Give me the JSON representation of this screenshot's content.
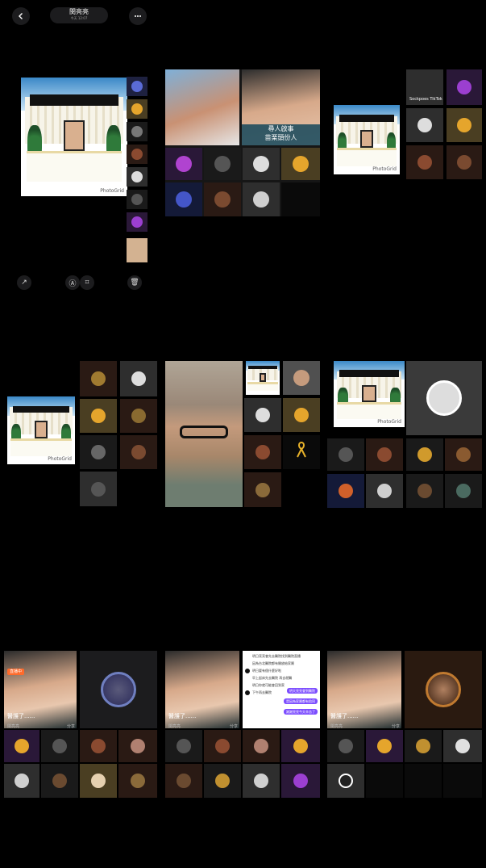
{
  "header": {
    "title": "閔亮亮",
    "subtitle": "今天 12:07",
    "back_icon": "chevron-left-icon",
    "more_icon": "more-dots-icon"
  },
  "viewer": {
    "watermark": "PhotoGrid",
    "actions": [
      "share-icon",
      "text-recognize-icon",
      "scan-icon",
      "trash-icon"
    ]
  },
  "panel2": {
    "caption_line1": "尋人啟事",
    "caption_line2": "苗栗頭份人"
  },
  "panel3": {
    "tiktok_label": "Sockpoes TikTok",
    "watermark": "PhotoGrid"
  },
  "panel4": {
    "watermark": "PhotoGrid"
  },
  "panel6": {
    "watermark": "PhotoGrid"
  },
  "video_panels": {
    "caption": "醫護了......",
    "username": "閔亮亮",
    "share_label": "分享",
    "badge": "直播中"
  },
  "chat_panel": {
    "lines": [
      "明日亮亮會先去醫院找到醫院直播",
      "因為台北醫院都有開放給家屬",
      "明日要有個什麼好啦",
      "早上起床先去醫院 再去就醫",
      "明日你就可能會回到家",
      "下午再去醫院"
    ],
    "sent": [
      "明天亮亮會到醫院",
      "是因為家屬都有陪同",
      "謝謝亮亮今天辛苦了"
    ]
  },
  "colors": {
    "background": "#000000",
    "pill": "#1c1c1e",
    "chat_purple": "#7c4dff"
  }
}
